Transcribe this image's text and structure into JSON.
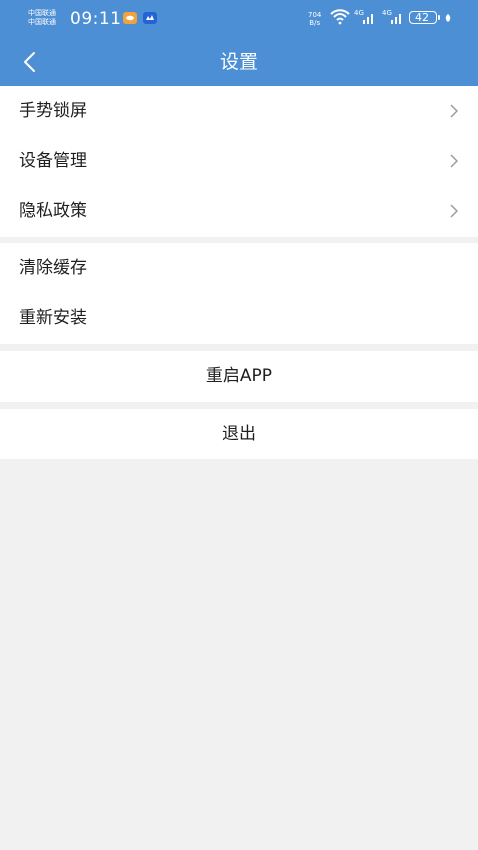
{
  "status_bar": {
    "carrier_1": "中国联通",
    "carrier_2": "中国联通",
    "time": "09:11",
    "net_speed_value": "704",
    "net_speed_unit": "B/s",
    "signal_1_label": "4G",
    "signal_2_label": "4G",
    "battery": "42"
  },
  "header": {
    "title": "设置",
    "back_icon": "chevron-left-icon"
  },
  "sections": {
    "main": [
      {
        "label": "手势锁屏",
        "icon": "chevron-right-icon"
      },
      {
        "label": "设备管理",
        "icon": "chevron-right-icon"
      },
      {
        "label": "隐私政策",
        "icon": "chevron-right-icon"
      }
    ],
    "maintenance": [
      {
        "label": "清除缓存"
      },
      {
        "label": "重新安装"
      }
    ],
    "restart_label": "重启APP",
    "logout_label": "退出"
  },
  "colors": {
    "header": "#4d8fd5",
    "background": "#f1f1f1",
    "chevron": "#9b9b9b"
  }
}
